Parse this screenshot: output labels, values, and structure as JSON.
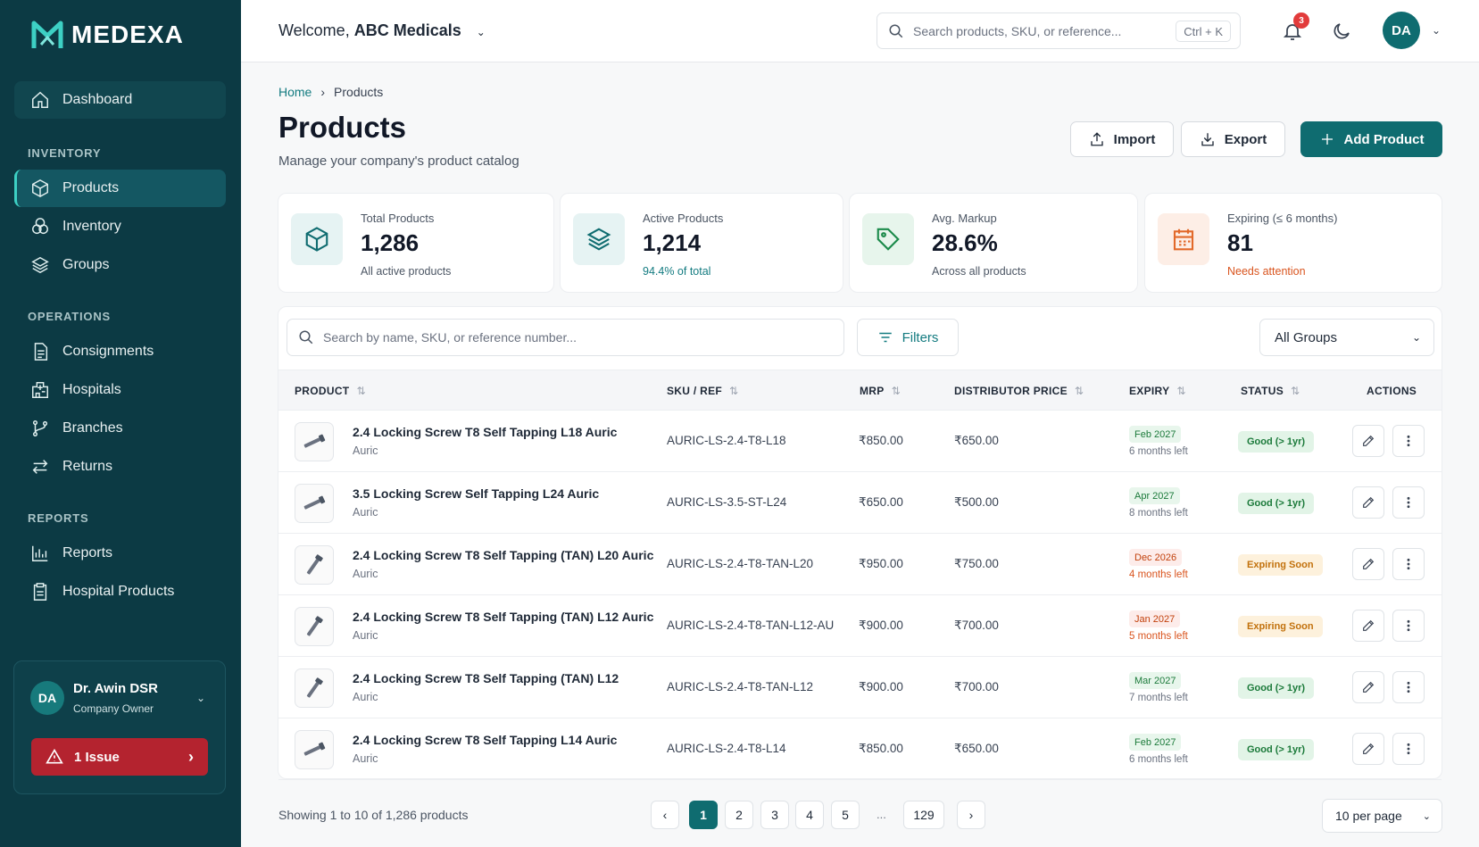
{
  "brand": {
    "name": "MEDEXA"
  },
  "sidebar": {
    "dashboard": "Dashboard",
    "sections": {
      "inventory": "INVENTORY",
      "operations": "OPERATIONS",
      "reports": "REPORTS"
    },
    "inventory_items": [
      "Products",
      "Inventory",
      "Groups"
    ],
    "operations_items": [
      "Consignments",
      "Hospitals",
      "Branches",
      "Returns"
    ],
    "reports_items": [
      "Reports",
      "Hospital Products"
    ],
    "active_item": "Products",
    "user": {
      "initials": "DA",
      "name": "Dr. Awin DSR",
      "role": "Company Owner"
    },
    "issue_label": "1 Issue"
  },
  "topbar": {
    "welcome_prefix": "Welcome,",
    "company": "ABC Medicals",
    "search_placeholder": "Search products, SKU, or reference...",
    "shortcut": "Ctrl + K",
    "notification_count": "3",
    "avatar_initials": "DA"
  },
  "breadcrumb": {
    "home": "Home",
    "current": "Products"
  },
  "page": {
    "title": "Products",
    "subtitle": "Manage your company's product catalog",
    "import_label": "Import",
    "export_label": "Export",
    "add_label": "Add Product"
  },
  "stats": [
    {
      "label": "Total Products",
      "value": "1,286",
      "note": "All active products",
      "icon": "cube-icon",
      "color": "#0f6c70",
      "note_color": "#4b5563"
    },
    {
      "label": "Active Products",
      "value": "1,214",
      "note": "94.4% of total",
      "icon": "layers-icon",
      "color": "#0f6c70",
      "note_color": "#137b80"
    },
    {
      "label": "Avg. Markup",
      "value": "28.6%",
      "note": "Across all products",
      "icon": "tag-icon",
      "color": "#1b8a4a",
      "note_color": "#4b5563"
    },
    {
      "label": "Expiring (≤ 6 months)",
      "value": "81",
      "note": "Needs attention",
      "icon": "calendar-icon",
      "color": "#e2692a",
      "note_color": "#d9541e"
    }
  ],
  "table": {
    "search_placeholder": "Search by name, SKU, or reference number...",
    "filters_label": "Filters",
    "group_filter": "All Groups",
    "columns": [
      "PRODUCT",
      "SKU / REF",
      "MRP",
      "DISTRIBUTOR PRICE",
      "EXPIRY",
      "STATUS",
      "ACTIONS"
    ],
    "rows": [
      {
        "name": "2.4 Locking Screw T8 Self Tapping L18 Auric",
        "brand": "Auric",
        "sku": "AURIC-LS-2.4-T8-L18",
        "mrp": "₹850.00",
        "dist": "₹650.00",
        "expiry": "Feb 2027",
        "left": "6 months left",
        "status": "Good (> 1yr)",
        "state": "good"
      },
      {
        "name": "3.5 Locking Screw Self Tapping L24 Auric",
        "brand": "Auric",
        "sku": "AURIC-LS-3.5-ST-L24",
        "mrp": "₹650.00",
        "dist": "₹500.00",
        "expiry": "Apr 2027",
        "left": "8 months left",
        "status": "Good (> 1yr)",
        "state": "good"
      },
      {
        "name": "2.4 Locking Screw T8 Self Tapping (TAN) L20 Auric",
        "brand": "Auric",
        "sku": "AURIC-LS-2.4-T8-TAN-L20",
        "mrp": "₹950.00",
        "dist": "₹750.00",
        "expiry": "Dec 2026",
        "left": "4 months left",
        "status": "Expiring Soon",
        "state": "warn"
      },
      {
        "name": "2.4 Locking Screw T8 Self Tapping (TAN) L12 Auric",
        "brand": "Auric",
        "sku": "AURIC-LS-2.4-T8-TAN-L12-AU",
        "mrp": "₹900.00",
        "dist": "₹700.00",
        "expiry": "Jan 2027",
        "left": "5 months left",
        "status": "Expiring Soon",
        "state": "warn"
      },
      {
        "name": "2.4 Locking Screw T8 Self Tapping (TAN) L12",
        "brand": "Auric",
        "sku": "AURIC-LS-2.4-T8-TAN-L12",
        "mrp": "₹900.00",
        "dist": "₹700.00",
        "expiry": "Mar 2027",
        "left": "7 months left",
        "status": "Good (> 1yr)",
        "state": "good"
      },
      {
        "name": "2.4 Locking Screw T8 Self Tapping L14 Auric",
        "brand": "Auric",
        "sku": "AURIC-LS-2.4-T8-L14",
        "mrp": "₹850.00",
        "dist": "₹650.00",
        "expiry": "Feb 2027",
        "left": "6 months left",
        "status": "Good (> 1yr)",
        "state": "good"
      }
    ]
  },
  "pagination": {
    "showing": "Showing 1 to 10 of 1,286 products",
    "pages": [
      "1",
      "2",
      "3",
      "4",
      "5"
    ],
    "ellipsis": "...",
    "last": "129",
    "current": "1",
    "per_page": "10 per page"
  },
  "colors": {
    "sidebar": "#0c3a44",
    "accent": "#0f6c70",
    "danger": "#b4232f"
  }
}
